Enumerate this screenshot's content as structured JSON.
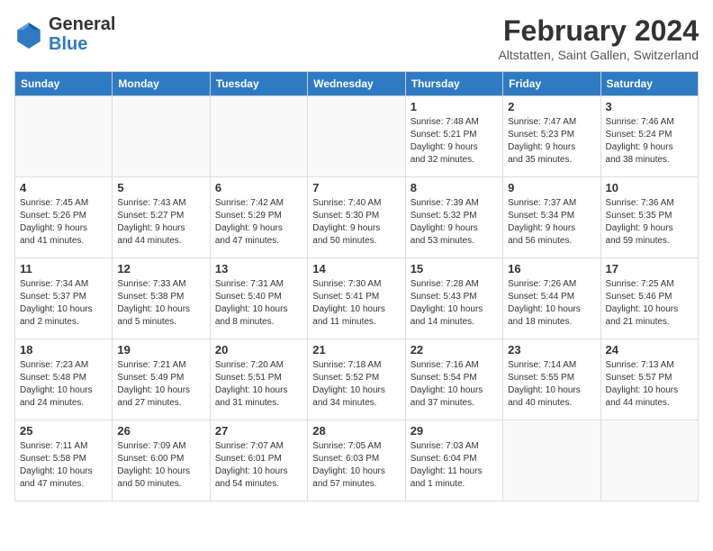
{
  "logo": {
    "general": "General",
    "blue": "Blue"
  },
  "title": {
    "month": "February 2024",
    "location": "Altstatten, Saint Gallen, Switzerland"
  },
  "weekdays": [
    "Sunday",
    "Monday",
    "Tuesday",
    "Wednesday",
    "Thursday",
    "Friday",
    "Saturday"
  ],
  "weeks": [
    [
      {
        "day": "",
        "info": ""
      },
      {
        "day": "",
        "info": ""
      },
      {
        "day": "",
        "info": ""
      },
      {
        "day": "",
        "info": ""
      },
      {
        "day": "1",
        "info": "Sunrise: 7:48 AM\nSunset: 5:21 PM\nDaylight: 9 hours\nand 32 minutes."
      },
      {
        "day": "2",
        "info": "Sunrise: 7:47 AM\nSunset: 5:23 PM\nDaylight: 9 hours\nand 35 minutes."
      },
      {
        "day": "3",
        "info": "Sunrise: 7:46 AM\nSunset: 5:24 PM\nDaylight: 9 hours\nand 38 minutes."
      }
    ],
    [
      {
        "day": "4",
        "info": "Sunrise: 7:45 AM\nSunset: 5:26 PM\nDaylight: 9 hours\nand 41 minutes."
      },
      {
        "day": "5",
        "info": "Sunrise: 7:43 AM\nSunset: 5:27 PM\nDaylight: 9 hours\nand 44 minutes."
      },
      {
        "day": "6",
        "info": "Sunrise: 7:42 AM\nSunset: 5:29 PM\nDaylight: 9 hours\nand 47 minutes."
      },
      {
        "day": "7",
        "info": "Sunrise: 7:40 AM\nSunset: 5:30 PM\nDaylight: 9 hours\nand 50 minutes."
      },
      {
        "day": "8",
        "info": "Sunrise: 7:39 AM\nSunset: 5:32 PM\nDaylight: 9 hours\nand 53 minutes."
      },
      {
        "day": "9",
        "info": "Sunrise: 7:37 AM\nSunset: 5:34 PM\nDaylight: 9 hours\nand 56 minutes."
      },
      {
        "day": "10",
        "info": "Sunrise: 7:36 AM\nSunset: 5:35 PM\nDaylight: 9 hours\nand 59 minutes."
      }
    ],
    [
      {
        "day": "11",
        "info": "Sunrise: 7:34 AM\nSunset: 5:37 PM\nDaylight: 10 hours\nand 2 minutes."
      },
      {
        "day": "12",
        "info": "Sunrise: 7:33 AM\nSunset: 5:38 PM\nDaylight: 10 hours\nand 5 minutes."
      },
      {
        "day": "13",
        "info": "Sunrise: 7:31 AM\nSunset: 5:40 PM\nDaylight: 10 hours\nand 8 minutes."
      },
      {
        "day": "14",
        "info": "Sunrise: 7:30 AM\nSunset: 5:41 PM\nDaylight: 10 hours\nand 11 minutes."
      },
      {
        "day": "15",
        "info": "Sunrise: 7:28 AM\nSunset: 5:43 PM\nDaylight: 10 hours\nand 14 minutes."
      },
      {
        "day": "16",
        "info": "Sunrise: 7:26 AM\nSunset: 5:44 PM\nDaylight: 10 hours\nand 18 minutes."
      },
      {
        "day": "17",
        "info": "Sunrise: 7:25 AM\nSunset: 5:46 PM\nDaylight: 10 hours\nand 21 minutes."
      }
    ],
    [
      {
        "day": "18",
        "info": "Sunrise: 7:23 AM\nSunset: 5:48 PM\nDaylight: 10 hours\nand 24 minutes."
      },
      {
        "day": "19",
        "info": "Sunrise: 7:21 AM\nSunset: 5:49 PM\nDaylight: 10 hours\nand 27 minutes."
      },
      {
        "day": "20",
        "info": "Sunrise: 7:20 AM\nSunset: 5:51 PM\nDaylight: 10 hours\nand 31 minutes."
      },
      {
        "day": "21",
        "info": "Sunrise: 7:18 AM\nSunset: 5:52 PM\nDaylight: 10 hours\nand 34 minutes."
      },
      {
        "day": "22",
        "info": "Sunrise: 7:16 AM\nSunset: 5:54 PM\nDaylight: 10 hours\nand 37 minutes."
      },
      {
        "day": "23",
        "info": "Sunrise: 7:14 AM\nSunset: 5:55 PM\nDaylight: 10 hours\nand 40 minutes."
      },
      {
        "day": "24",
        "info": "Sunrise: 7:13 AM\nSunset: 5:57 PM\nDaylight: 10 hours\nand 44 minutes."
      }
    ],
    [
      {
        "day": "25",
        "info": "Sunrise: 7:11 AM\nSunset: 5:58 PM\nDaylight: 10 hours\nand 47 minutes."
      },
      {
        "day": "26",
        "info": "Sunrise: 7:09 AM\nSunset: 6:00 PM\nDaylight: 10 hours\nand 50 minutes."
      },
      {
        "day": "27",
        "info": "Sunrise: 7:07 AM\nSunset: 6:01 PM\nDaylight: 10 hours\nand 54 minutes."
      },
      {
        "day": "28",
        "info": "Sunrise: 7:05 AM\nSunset: 6:03 PM\nDaylight: 10 hours\nand 57 minutes."
      },
      {
        "day": "29",
        "info": "Sunrise: 7:03 AM\nSunset: 6:04 PM\nDaylight: 11 hours\nand 1 minute."
      },
      {
        "day": "",
        "info": ""
      },
      {
        "day": "",
        "info": ""
      }
    ]
  ]
}
